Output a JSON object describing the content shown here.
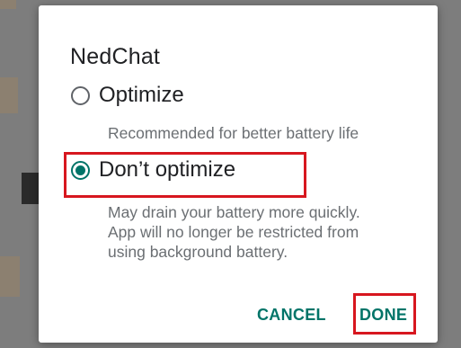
{
  "dialog": {
    "title": "NedChat",
    "options": [
      {
        "label": "Optimize",
        "description": "Recommended for better battery life",
        "selected": false
      },
      {
        "label": "Don’t optimize",
        "description_lines": [
          "May drain your battery more quickly.",
          "App will no longer be restricted from",
          "using background battery."
        ],
        "selected": true
      }
    ],
    "buttons": {
      "cancel": "CANCEL",
      "done": "DONE"
    }
  },
  "colors": {
    "accent": "#007468",
    "highlight": "#d7171f",
    "scrim": "#7d7d7d"
  }
}
